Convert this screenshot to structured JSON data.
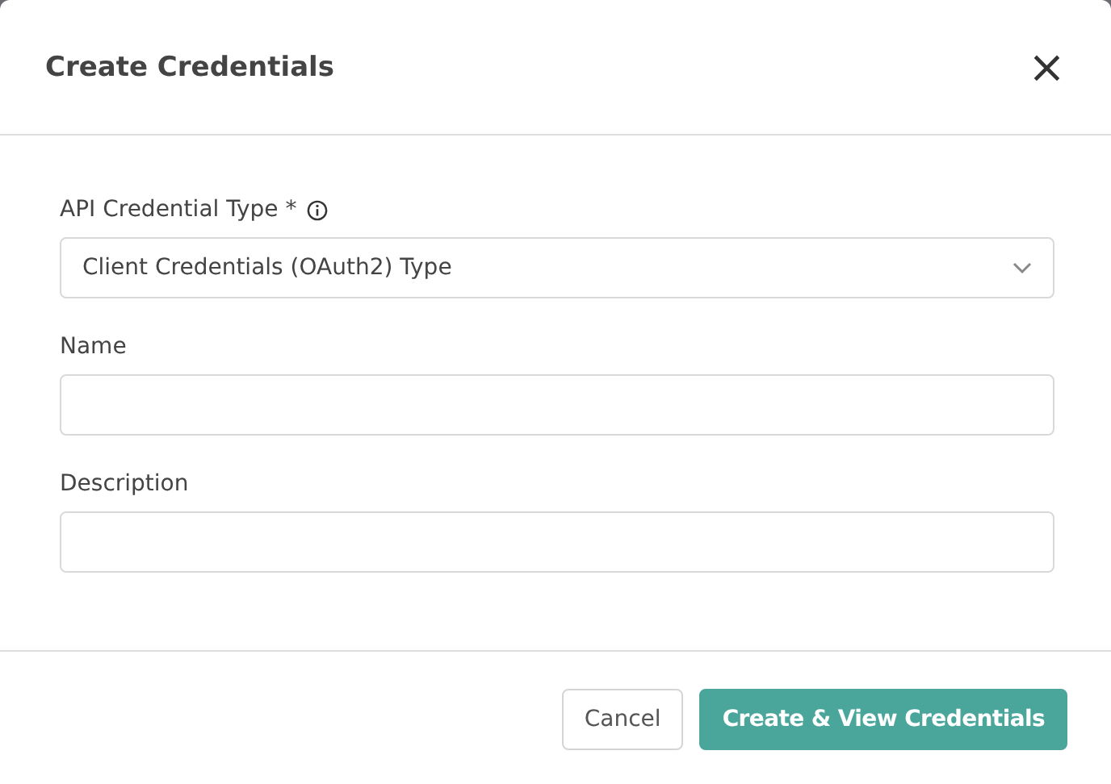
{
  "dialog": {
    "title": "Create Credentials",
    "close": "×"
  },
  "fields": [
    {
      "kind": "select",
      "label": "API Credential Type *",
      "info": true,
      "value": "Client Credentials (OAuth2) Type"
    },
    {
      "kind": "text",
      "label": "Name"
    },
    {
      "kind": "text",
      "label": "Description"
    }
  ],
  "buttons": [
    {
      "label": "Cancel",
      "kind": "secondary"
    },
    {
      "label": "Create & View Credentials",
      "kind": "primary"
    }
  ]
}
